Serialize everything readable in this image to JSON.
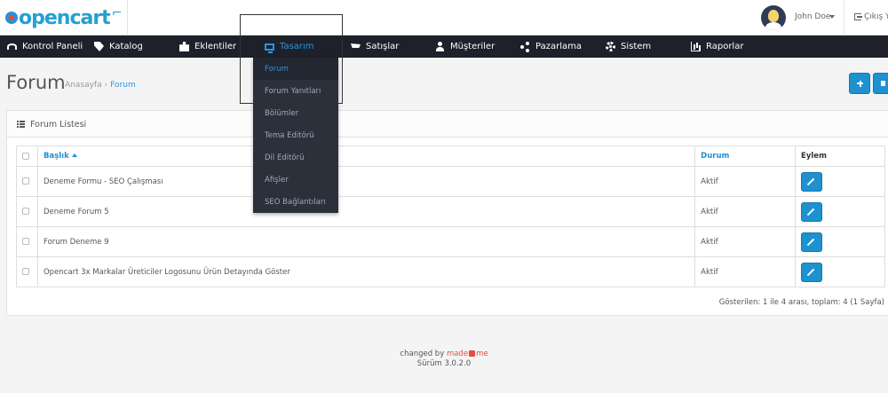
{
  "brand": {
    "logo_text": "opencart"
  },
  "header": {
    "user_name": "John Doe",
    "logout_label": "Çıkış Ya"
  },
  "nav": {
    "items": [
      {
        "label": "Kontrol Paneli",
        "icon": "dashboard-icon"
      },
      {
        "label": "Katalog",
        "icon": "tag-icon"
      },
      {
        "label": "Eklentiler",
        "icon": "puzzle-icon"
      },
      {
        "label": "Tasarım",
        "icon": "monitor-icon",
        "active": true
      },
      {
        "label": "Satışlar",
        "icon": "cart-icon"
      },
      {
        "label": "Müşteriler",
        "icon": "user-icon"
      },
      {
        "label": "Pazarlama",
        "icon": "share-icon"
      },
      {
        "label": "Sistem",
        "icon": "gear-icon"
      },
      {
        "label": "Raporlar",
        "icon": "bar-chart-icon"
      }
    ]
  },
  "dropdown": {
    "items": [
      {
        "label": "Forum",
        "active": true
      },
      {
        "label": "Forum Yanıtları"
      },
      {
        "label": "Bölümler"
      },
      {
        "label": "Tema Editörü"
      },
      {
        "label": "Dil Editörü"
      },
      {
        "label": "Afişler"
      },
      {
        "label": "SEO Bağlantıları"
      }
    ]
  },
  "page": {
    "title": "Forum",
    "breadcrumb": [
      "Anasayfa",
      "Forum"
    ]
  },
  "panel": {
    "title": "Forum Listesi",
    "columns": {
      "title": "Başlık",
      "status": "Durum",
      "action": "Eylem"
    },
    "rows": [
      {
        "title": "Deneme Formu - SEO Çalışması",
        "status": "Aktif"
      },
      {
        "title": "Deneme Forum 5",
        "status": "Aktif"
      },
      {
        "title": "Forum Deneme 9",
        "status": "Aktif"
      },
      {
        "title": "Opencart 3x Markalar Üreticiler Logosunu Ürün Detayında Göster",
        "status": "Aktif"
      }
    ],
    "pagination_text": "Gösterilen: 1 ile 4 arası, toplam: 4 (1 Sayfa)"
  },
  "footer": {
    "changed_by": "changed by",
    "made_a": "made",
    "made_b": "me",
    "version": "Sürüm 3.0.2.0"
  },
  "colors": {
    "nav_bg": "#1e2129",
    "accent": "#1e91cf",
    "dropdown_bg": "#2b303b",
    "brand_red": "#e74c3c"
  }
}
